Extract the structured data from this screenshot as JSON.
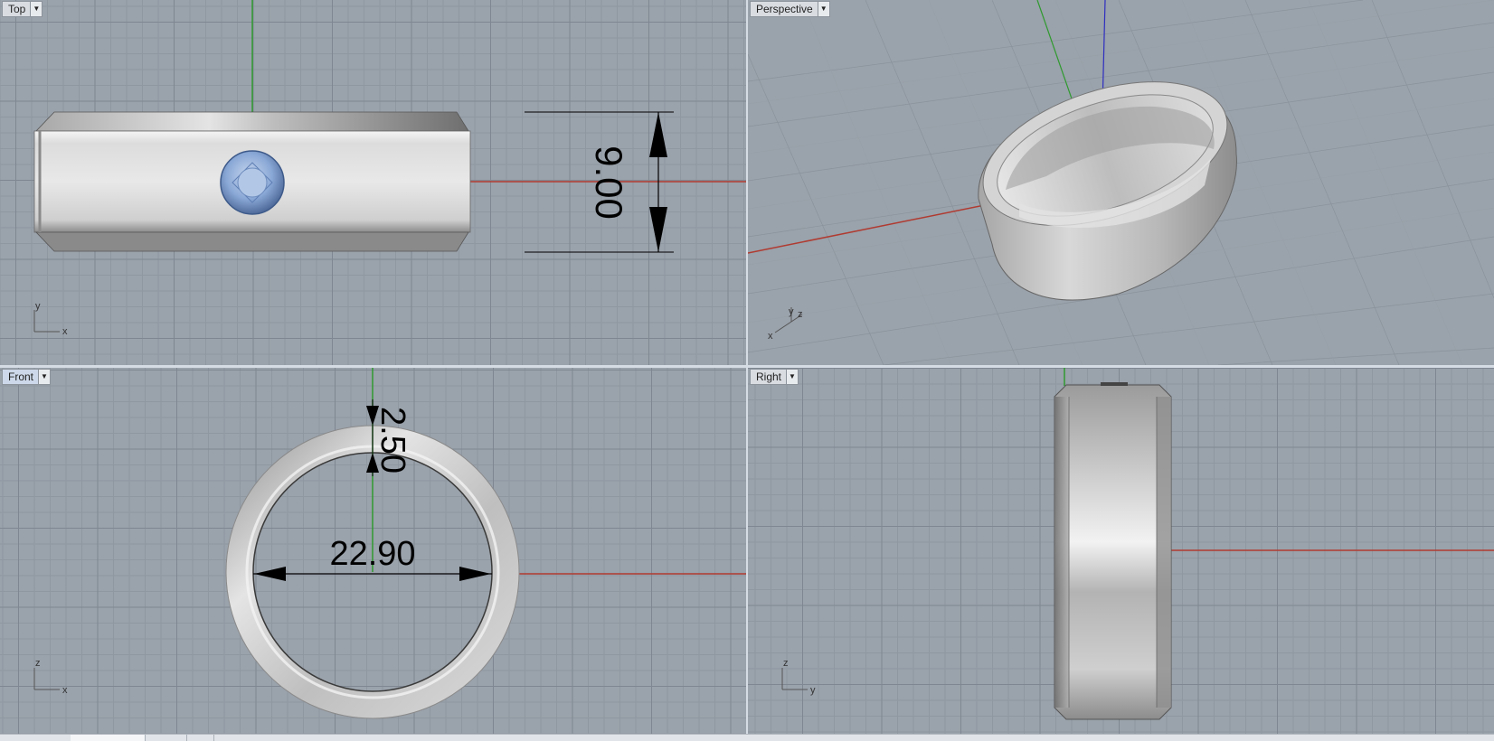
{
  "viewports": {
    "top": {
      "label": "Top",
      "axis_h": "x",
      "axis_v": "y",
      "dimension": "9.00"
    },
    "perspective": {
      "label": "Perspective",
      "axis_h": "x",
      "axis_v": "y",
      "axis_z": "z"
    },
    "front": {
      "label": "Front",
      "axis_h": "x",
      "axis_v": "z",
      "dimension_thickness": "2.50",
      "dimension_diameter": "22.90"
    },
    "right": {
      "label": "Right",
      "axis_h": "y",
      "axis_v": "z"
    }
  },
  "icons": {
    "dropdown": "chevron-down-icon"
  },
  "colors": {
    "viewport_bg": "#9aa2ab",
    "x_axis": "#b03a30",
    "y_axis": "#2f9a2f",
    "z_axis": "#2e2ec0",
    "gem": "#7e9fd0",
    "metal": "#c8c9cb",
    "active_tab": "#cdd9ea"
  }
}
